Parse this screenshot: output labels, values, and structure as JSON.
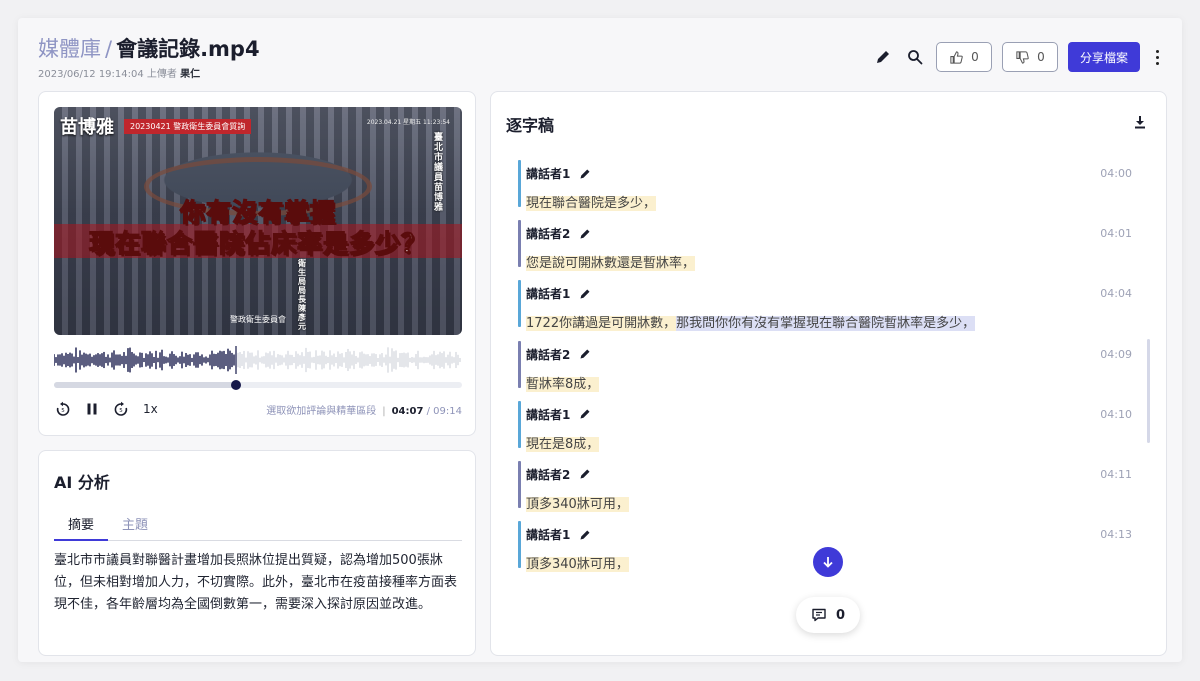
{
  "header": {
    "library": "媒體庫",
    "separator": "/",
    "file_name": "會議記錄.mp4",
    "uploaded_at": "2023/06/12 19:14:04",
    "uploaded_label": "上傳者",
    "uploader": "果仁"
  },
  "toolbar": {
    "icons": [
      "pencil-icon",
      "search-icon",
      "thumbs-up-icon",
      "thumbs-down-icon",
      "more-icon"
    ],
    "likes": "0",
    "dislikes": "0",
    "share_label": "分享檔案"
  },
  "video": {
    "badge": "苗博雅",
    "tag": "20230421 警政衛生委員會質詢",
    "date": "2023.04.21 星期五 11:23:54",
    "side_title": "臺北市議員苗博雅",
    "caption_line1": "你有沒有掌握",
    "caption_line2": "現在聯合醫院佔床率是多少？",
    "speaker_title": "衛生局局長陳彥元",
    "footer": "警政衛生委員會"
  },
  "player": {
    "progress": 0.445,
    "speed": "1x",
    "hint": "選取欲加評論與精華區段",
    "divider": "|",
    "current_time": "04:07",
    "total_time": "/ 09:14"
  },
  "ai": {
    "title": "AI 分析",
    "tabs": [
      {
        "label": "摘要",
        "active": true
      },
      {
        "label": "主題",
        "active": false
      }
    ],
    "summary": "臺北市市議員對聯醫計畫增加長照牀位提出質疑，認為增加500張牀位，但未相對增加人力，不切實際。此外，臺北市在疫苗接種率方面表現不佳，各年齡層均為全國倒數第一，需要深入探討原因並改進。"
  },
  "transcript": {
    "title": "逐字稿",
    "segments": [
      {
        "speaker": "講話者1",
        "time": "04:00",
        "text": "現在聯合醫院是多少，",
        "extra": ""
      },
      {
        "speaker": "講話者2",
        "time": "04:01",
        "text": "您是說可開牀數還是暫牀率，",
        "extra": ""
      },
      {
        "speaker": "講話者1",
        "time": "04:04",
        "text": "1722你講過是可開牀數，",
        "extra": "那我問你你有沒有掌握現在聯合醫院暫牀率是多少，"
      },
      {
        "speaker": "講話者2",
        "time": "04:09",
        "text": "暫牀率8成，",
        "extra": ""
      },
      {
        "speaker": "講話者1",
        "time": "04:10",
        "text": "現在是8成，",
        "extra": ""
      },
      {
        "speaker": "講話者2",
        "time": "04:11",
        "text": "頂多340牀可用，",
        "extra": ""
      },
      {
        "speaker": "講話者1",
        "time": "04:13",
        "text": "頂多340牀可用，",
        "extra": ""
      }
    ],
    "comment_count": "0"
  },
  "colors": {
    "accent": "#3f3ad8",
    "speaker1_bar": "#59a7d8",
    "speaker2_bar": "#7a7fb0",
    "highlight": "#fbf0cf",
    "highlight_active": "#dcdff5"
  }
}
